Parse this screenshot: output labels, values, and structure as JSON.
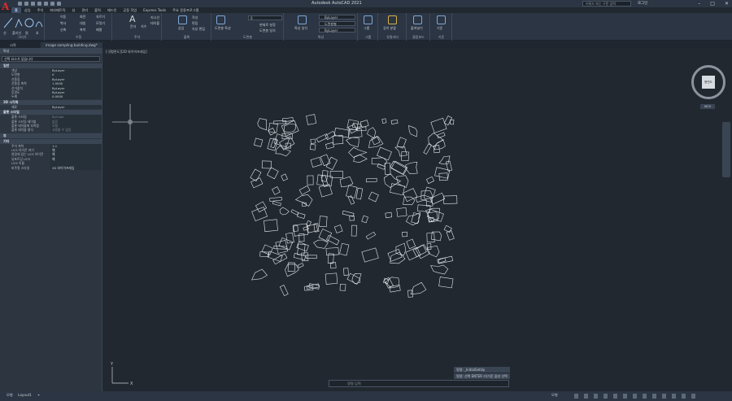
{
  "app": {
    "title": "Autodesk AutoCAD 2021",
    "search_placeholder": "키워드 또는 구문 입력",
    "login_label": "로그인",
    "logo_letter": "A"
  },
  "ribbon_tabs": [
    "홈",
    "삽입",
    "주석",
    "파라메트릭",
    "뷰",
    "관리",
    "출력",
    "애드인",
    "공동 작업",
    "Express Tools",
    "주요 응용프로그램"
  ],
  "ribbon": {
    "draw_group": "그리기",
    "modify_group": "수정",
    "annotation_group": "주석",
    "layer_group": "도면층",
    "block_group": "블록",
    "properties_group": "특성",
    "group_group": "그룹",
    "utilities_group": "유틸리티",
    "clipboard_group": "클립보드",
    "view_group": "기준",
    "line_label": "선",
    "polyline_label": "폴리선",
    "circle_label": "원",
    "arc_label": "호",
    "move_label": "이동",
    "rotate_label": "회전",
    "trim_label": "자르기",
    "copy_label": "복사",
    "mirror_label": "대칭",
    "fillet_label": "모깎기",
    "stretch_label": "신축",
    "scale_label": "축척",
    "array_label": "배열",
    "text_label": "문자",
    "dimension_label": "치수",
    "leader_label": "지시선",
    "table_label": "테이블",
    "insert_label": "삽입",
    "create_label": "작성",
    "edit_label": "편집",
    "attr_label": "속성 편집",
    "layer_props_label": "도면층 특성",
    "layer_current": "0",
    "make_current_label": "현재로 설정",
    "match_layer_label": "도면층 일치",
    "match_props_label": "특성 일치",
    "color_value": "ByLayer",
    "linetype_value": "도면층별",
    "lineweight_value": "ByLayer",
    "group_label": "그룹",
    "measure_label": "길이 분할",
    "paste_label": "붙여넣기",
    "base_label": "기준"
  },
  "doc_tabs": [
    {
      "label": "시작",
      "active": false
    },
    {
      "label": "image sampling building.dwg*",
      "active": true
    }
  ],
  "canvas": {
    "view_label": "[-][평면도][2D 와이어프레임]",
    "command_input_placeholder": "명령 입력",
    "history": [
      "명령: _InitialSetUp",
      "명령: 선택 ENTER 키/기준 옵션 선택"
    ]
  },
  "viewcube": {
    "face": "평면도",
    "wcs": "WCS"
  },
  "properties_panel": {
    "title": "특성",
    "selection": "선택 요소가 없습니다",
    "sections": [
      {
        "name": "일반",
        "rows": [
          [
            "색상",
            "ByLayer"
          ],
          [
            "도면층",
            "0"
          ],
          [
            "선종류",
            "ByLayer"
          ],
          [
            "선종류 축척",
            "1.0000"
          ],
          [
            "선가중치",
            "ByLayer"
          ],
          [
            "투명도",
            "ByLayer"
          ],
          [
            "두께",
            "0.0000"
          ]
        ]
      },
      {
        "name": "3D 시각화",
        "rows": [
          [
            "재료",
            "ByLayer"
          ]
        ]
      },
      {
        "name": "플롯 스타일",
        "rows": [
          [
            "플롯 스타일",
            "ByColor"
          ],
          [
            "플롯 스타일 테이블",
            "없음"
          ],
          [
            "플롯 테이블에 부착됨",
            "모형"
          ],
          [
            "플롯 테이블 형식",
            "사용할 수 없음"
          ]
        ]
      },
      {
        "name": "뷰",
        "rows": []
      },
      {
        "name": "기타",
        "rows": [
          [
            "주석 축척",
            "1:1"
          ],
          [
            "UCS 아이콘 켜기",
            "예"
          ],
          [
            "원점에 있는 UCS 아이콘",
            "예"
          ],
          [
            "뷰포트당 UCS",
            "예"
          ],
          [
            "UCS 이름",
            ""
          ],
          [
            "비주얼 스타일",
            "2D 와이어프레임"
          ]
        ]
      }
    ]
  },
  "status": {
    "model_tab": "모형",
    "layout_tab": "Layout1",
    "add_tab": "+",
    "model_button": "모형"
  },
  "colors": {
    "canvas_bg": "#212830",
    "ribbon_bg": "#2b3543",
    "drawing_line": "#e6e9ee",
    "accent": "#3b4d66"
  }
}
